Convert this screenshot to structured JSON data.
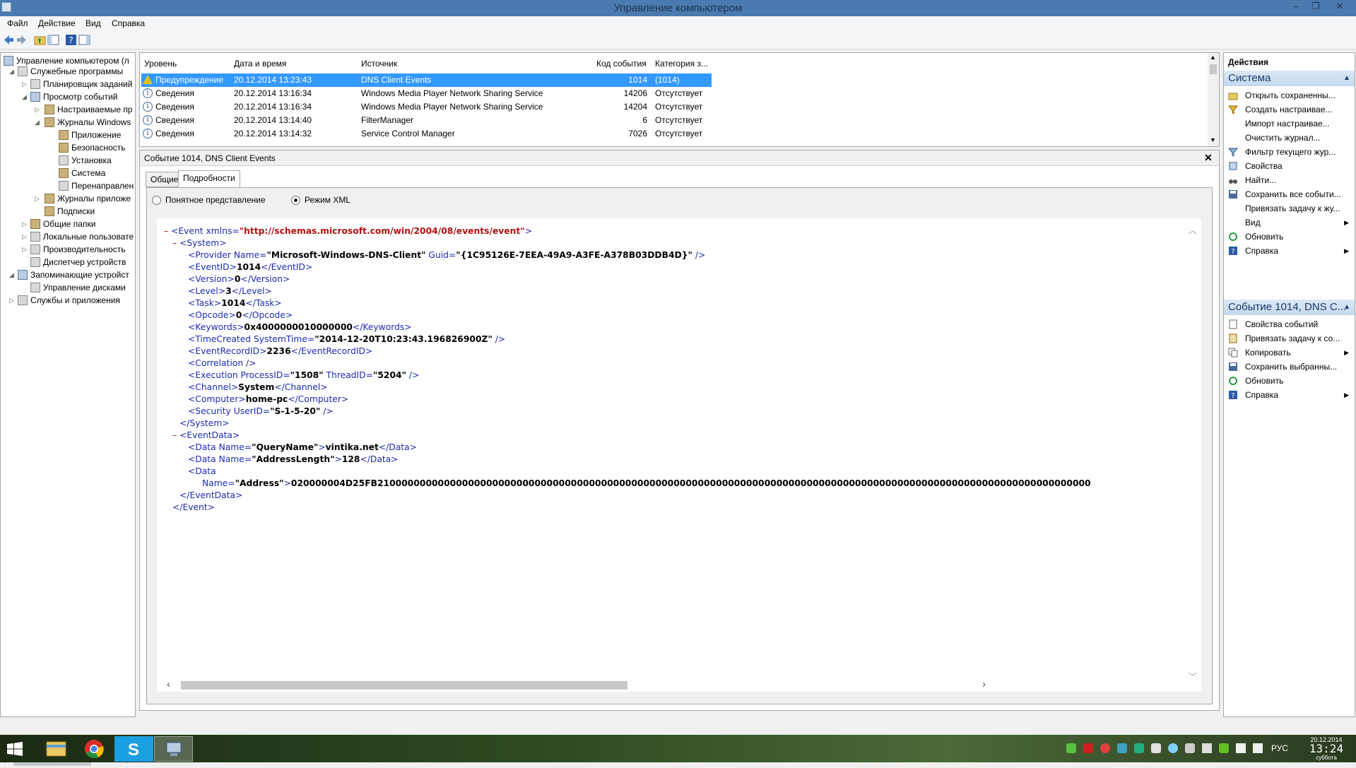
{
  "window": {
    "title": "Управление компьютером",
    "minimize": "–",
    "restore": "❐",
    "close": "✕"
  },
  "menu": [
    "Файл",
    "Действие",
    "Вид",
    "Справка"
  ],
  "tree": [
    {
      "label": "Управление компьютером (л",
      "icon": "computer-management-icon"
    },
    {
      "label": "Служебные программы",
      "icon": "tools-icon"
    },
    {
      "label": "Планировщик заданий",
      "icon": "clock-icon"
    },
    {
      "label": "Просмотр событий",
      "icon": "event-viewer-icon"
    },
    {
      "label": "Настраиваемые пр",
      "icon": "folder-icon"
    },
    {
      "label": "Журналы Windows",
      "icon": "folder-icon"
    },
    {
      "label": "Приложение",
      "icon": "log-icon"
    },
    {
      "label": "Безопасность",
      "icon": "log-icon"
    },
    {
      "label": "Установка",
      "icon": "log-icon"
    },
    {
      "label": "Система",
      "icon": "log-icon"
    },
    {
      "label": "Перенаправлен",
      "icon": "log-icon"
    },
    {
      "label": "Журналы приложе",
      "icon": "folder-icon"
    },
    {
      "label": "Подписки",
      "icon": "subscription-icon"
    },
    {
      "label": "Общие папки",
      "icon": "shared-folder-icon"
    },
    {
      "label": "Локальные пользовате",
      "icon": "users-icon"
    },
    {
      "label": "Производительность",
      "icon": "performance-icon"
    },
    {
      "label": "Диспетчер устройств",
      "icon": "device-manager-icon"
    },
    {
      "label": "Запоминающие устройст",
      "icon": "storage-icon"
    },
    {
      "label": "Управление дисками",
      "icon": "disk-icon"
    },
    {
      "label": "Службы и приложения",
      "icon": "services-icon"
    }
  ],
  "list": {
    "headers": [
      "Уровень",
      "Дата и время",
      "Источник",
      "Код события",
      "Категория з..."
    ],
    "rows": [
      {
        "level": "Предупреждение",
        "date": "20.12.2014 13:23:43",
        "source": "DNS Client Events",
        "code": "1014",
        "category": "(1014)",
        "type": "warning"
      },
      {
        "level": "Сведения",
        "date": "20.12.2014 13:16:34",
        "source": "Windows Media Player Network Sharing Service",
        "code": "14206",
        "category": "Отсутствует",
        "type": "info"
      },
      {
        "level": "Сведения",
        "date": "20.12.2014 13:16:34",
        "source": "Windows Media Player Network Sharing Service",
        "code": "14204",
        "category": "Отсутствует",
        "type": "info"
      },
      {
        "level": "Сведения",
        "date": "20.12.2014 13:14:40",
        "source": "FilterManager",
        "code": "6",
        "category": "Отсутствует",
        "type": "info"
      },
      {
        "level": "Сведения",
        "date": "20.12.2014 13:14:32",
        "source": "Service Control Manager",
        "code": "7026",
        "category": "Отсутствует",
        "type": "info"
      }
    ]
  },
  "detail": {
    "title": "Событие 1014, DNS Client Events",
    "tabs": [
      "Общие",
      "Подробности"
    ],
    "radio_friendly": "Понятное представление",
    "radio_xml": "Режим XML"
  },
  "xml": {
    "event_open": "<Event xmlns=",
    "event_ns": "\"http://schemas.microsoft.com/win/2004/08/events/event\"",
    "event_gt": ">",
    "system_open": "<System>",
    "provider_tag": "<Provider Name=",
    "provider_name": "\"Microsoft-Windows-DNS-Client\"",
    "guid_attr": " Guid=",
    "guid_val": "\"{1C95126E-7EEA-49A9-A3FE-A378B03DDB4D}\"",
    "selfclose": " />",
    "eventid_open": "<EventID>",
    "eventid_val": "1014",
    "eventid_close": "</EventID>",
    "version_open": "<Version>",
    "version_val": "0",
    "version_close": "</Version>",
    "level_open": "<Level>",
    "level_val": "3",
    "level_close": "</Level>",
    "task_open": "<Task>",
    "task_val": "1014",
    "task_close": "</Task>",
    "opcode_open": "<Opcode>",
    "opcode_val": "0",
    "opcode_close": "</Opcode>",
    "keywords_open": "<Keywords>",
    "keywords_val": "0x4000000010000000",
    "keywords_close": "</Keywords>",
    "timecreated_tag": "<TimeCreated SystemTime=",
    "timecreated_val": "\"2014-12-20T10:23:43.196826900Z\"",
    "recordid_open": "<EventRecordID>",
    "recordid_val": "2236",
    "recordid_close": "</EventRecordID>",
    "correlation": "<Correlation />",
    "execution_tag": "<Execution ProcessID=",
    "process_val": "\"1508\"",
    "thread_attr": " ThreadID=",
    "thread_val": "\"5204\"",
    "channel_open": "<Channel>",
    "channel_val": "System",
    "channel_close": "</Channel>",
    "computer_open": "<Computer>",
    "computer_val": "home-pc",
    "computer_close": "</Computer>",
    "security_tag": "<Security UserID=",
    "security_val": "\"S-1-5-20\"",
    "system_close": "</System>",
    "eventdata_open": "<EventData>",
    "data_name_tag": "<Data Name=",
    "queryname_attr": "\"QueryName\"",
    "queryname_val": "vintika.net",
    "data_close": "</Data>",
    "addrlen_attr": "\"AddressLength\"",
    "addrlen_val": "128",
    "data_open": "<Data",
    "name_attr": "Name=",
    "address_attr": "\"Address\"",
    "address_val": "020000004D25FB2100000000000000000000000000000000000000000000000000000000000000000000000000000000000000000000000000000000000000000000",
    "eventdata_close": "</EventData>",
    "event_close": "</Event>",
    "minus": "–"
  },
  "actions": {
    "header": "Действия",
    "section1": "Система",
    "items1": [
      {
        "label": "Открыть сохраненны...",
        "icon": "open-folder-icon"
      },
      {
        "label": "Создать настраивае...",
        "icon": "filter-create-icon"
      },
      {
        "label": "Импорт настраивае...",
        "icon": ""
      },
      {
        "label": "Очистить журнал...",
        "icon": ""
      },
      {
        "label": "Фильтр текущего жур...",
        "icon": "filter-icon"
      },
      {
        "label": "Свойства",
        "icon": "properties-icon"
      },
      {
        "label": "Найти...",
        "icon": "binoculars-icon"
      },
      {
        "label": "Сохранить все событи...",
        "icon": "save-icon"
      },
      {
        "label": "Привязать задачу к жу...",
        "icon": ""
      },
      {
        "label": "Вид",
        "icon": "",
        "submenu": true
      },
      {
        "label": "Обновить",
        "icon": "refresh-icon"
      },
      {
        "label": "Справка",
        "icon": "help-icon",
        "submenu": true
      }
    ],
    "section2": "Событие 1014, DNS C...",
    "items2": [
      {
        "label": "Свойства событий",
        "icon": "event-properties-icon"
      },
      {
        "label": "Привязать задачу к со...",
        "icon": "task-icon"
      },
      {
        "label": "Копировать",
        "icon": "copy-icon",
        "submenu": true
      },
      {
        "label": "Сохранить выбранны...",
        "icon": "save-icon"
      },
      {
        "label": "Обновить",
        "icon": "refresh-icon"
      },
      {
        "label": "Справка",
        "icon": "help-icon",
        "submenu": true
      }
    ]
  },
  "taskbar": {
    "lang": "РУС",
    "date": "20.12.2014",
    "time": "13:24",
    "day": "суббота"
  },
  "colors": {
    "selection": "#3399ff",
    "xml_tag": "#1e2bb0",
    "xml_attr_value": "#b01010",
    "titlebar": "#4a7ab0"
  }
}
